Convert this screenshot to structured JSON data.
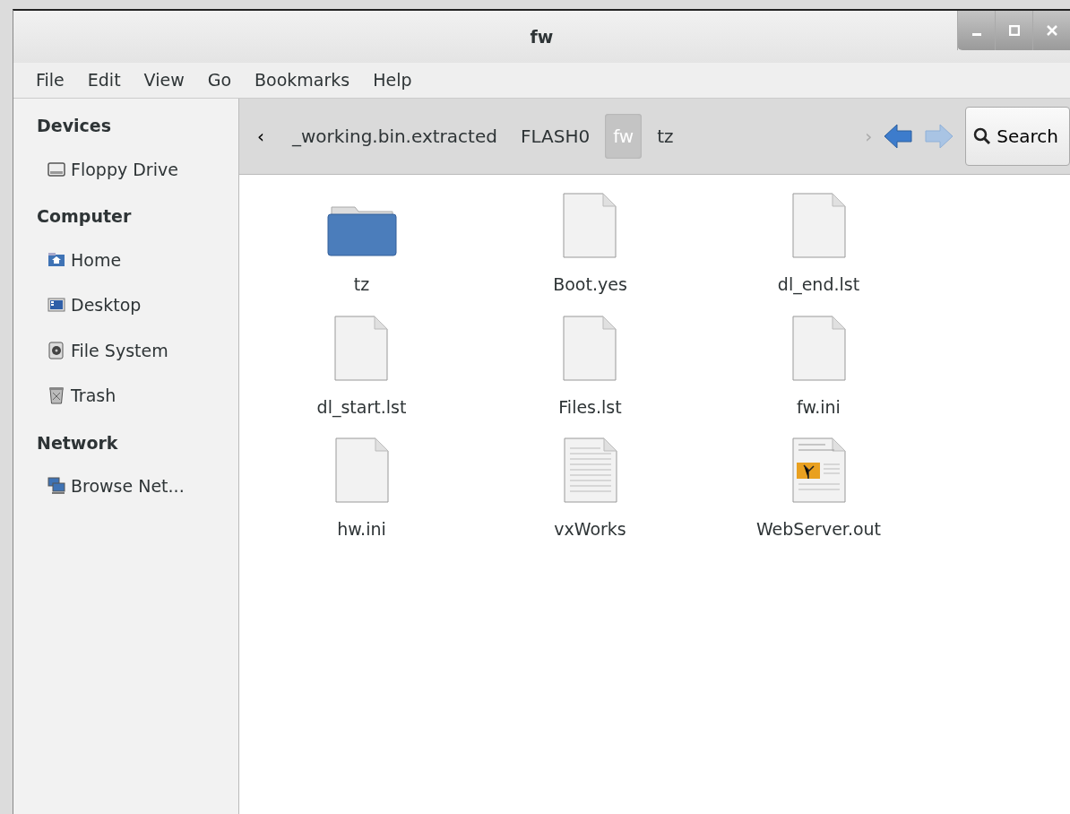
{
  "window": {
    "title": "fw"
  },
  "menu": [
    "File",
    "Edit",
    "View",
    "Go",
    "Bookmarks",
    "Help"
  ],
  "sidebar": [
    {
      "heading": "Devices",
      "items": [
        {
          "label": "Floppy Drive",
          "kind": "floppy"
        }
      ]
    },
    {
      "heading": "Computer",
      "items": [
        {
          "label": "Home",
          "kind": "home"
        },
        {
          "label": "Desktop",
          "kind": "desktop"
        },
        {
          "label": "File System",
          "kind": "filesystem"
        },
        {
          "label": "Trash",
          "kind": "trash"
        }
      ]
    },
    {
      "heading": "Network",
      "items": [
        {
          "label": "Browse Net...",
          "kind": "network"
        }
      ]
    }
  ],
  "pathbar": {
    "scroll_left": "‹",
    "crumbs": [
      {
        "label": "_working.bin.extracted",
        "selected": false
      },
      {
        "label": "FLASH0",
        "selected": false
      },
      {
        "label": "fw",
        "selected": true
      },
      {
        "label": "tz",
        "selected": false
      }
    ],
    "scroll_right": "›",
    "back_disabled": false,
    "forward_disabled": true,
    "search": "Search"
  },
  "files": [
    {
      "name": "tz",
      "kind": "folder"
    },
    {
      "name": "Boot.yes",
      "kind": "blank"
    },
    {
      "name": "dl_end.lst",
      "kind": "blank"
    },
    {
      "name": "dl_start.lst",
      "kind": "blank"
    },
    {
      "name": "Files.lst",
      "kind": "blank"
    },
    {
      "name": "fw.ini",
      "kind": "blank"
    },
    {
      "name": "hw.ini",
      "kind": "blank"
    },
    {
      "name": "vxWorks",
      "kind": "text"
    },
    {
      "name": "WebServer.out",
      "kind": "image-doc"
    }
  ]
}
